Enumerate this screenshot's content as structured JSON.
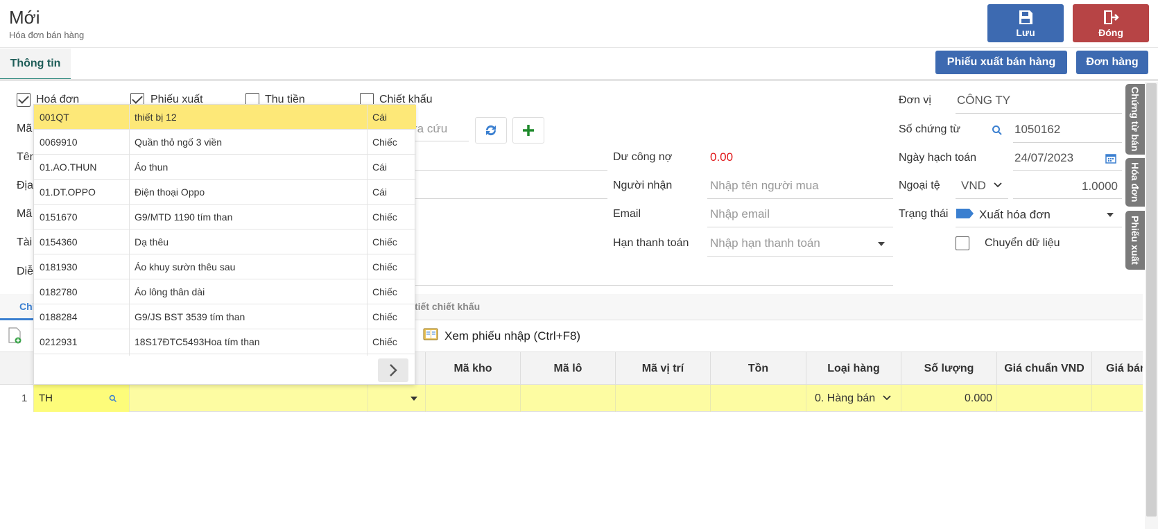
{
  "header": {
    "title": "Mới",
    "subtitle": "Hóa đơn bán hàng",
    "save_label": "Lưu",
    "close_label": "Đóng"
  },
  "tabs": {
    "info_label": "Thông tin",
    "phieu_xuat_btn": "Phiếu xuất bán hàng",
    "don_hang_btn": "Đơn hàng"
  },
  "checkboxes": [
    {
      "label": "Hoá đơn",
      "checked": true
    },
    {
      "label": "Phiếu xuất",
      "checked": true
    },
    {
      "label": "Thu tiền",
      "checked": false
    },
    {
      "label": "Chiết khấu",
      "checked": false
    }
  ],
  "left_labels": [
    "Mã",
    "Tên",
    "Địa",
    "Mã",
    "Tài",
    "Diễ"
  ],
  "lookup": {
    "placeholder_fragment": "ra cứu"
  },
  "middle": {
    "du_cong_no_label": "Dư công nợ",
    "du_cong_no_value": "0.00",
    "nguoi_nhan_label": "Người nhận",
    "nguoi_nhan_placeholder": "Nhập tên người mua",
    "email_label": "Email",
    "email_placeholder": "Nhập email",
    "han_tt_label": "Hạn thanh toán",
    "han_tt_placeholder": "Nhập hạn thanh toán"
  },
  "right": {
    "don_vi_label": "Đơn vị",
    "don_vi_value": "CÔNG TY",
    "so_chung_tu_label": "Số chứng từ",
    "so_chung_tu_value": "1050162",
    "ngay_hach_toan_label": "Ngày hạch toán",
    "ngay_hach_toan_value": "24/07/2023",
    "ngoai_te_label": "Ngoại tệ",
    "ngoai_te_value": "VND",
    "ty_gia_value": "1.0000",
    "trang_thai_label": "Trạng thái",
    "trang_thai_value": "Xuất hóa đơn",
    "chuyen_du_lieu_label": "Chuyển dữ liệu"
  },
  "side_tabs": [
    "Chứng từ bán",
    "Hóa đơn",
    "Phiếu xuất"
  ],
  "detail_tabs": {
    "first_fragment": "Chi",
    "discount_fragment": "tiết chiết khấu"
  },
  "toolbar": {
    "view_import_label": "Xem phiếu nhập (Ctrl+F8)"
  },
  "dropdown": {
    "rows": [
      {
        "code": "001QT",
        "name": "thiết bị 12",
        "unit": "Cái"
      },
      {
        "code": "0069910",
        "name": "Quần thỏ ngố 3 viền",
        "unit": "Chiếc"
      },
      {
        "code": "01.AO.THUN",
        "name": "Áo thun",
        "unit": "Cái"
      },
      {
        "code": "01.DT.OPPO",
        "name": "Điện thoại Oppo",
        "unit": "Cái"
      },
      {
        "code": "0151670",
        "name": "G9/MTD 1190 tím than",
        "unit": "Chiếc"
      },
      {
        "code": "0154360",
        "name": "Dạ thêu",
        "unit": "Chiếc"
      },
      {
        "code": "0181930",
        "name": "Áo khuy sườn thêu sau",
        "unit": "Chiếc"
      },
      {
        "code": "0182780",
        "name": "Áo lông thân dài",
        "unit": "Chiếc"
      },
      {
        "code": "0188284",
        "name": "G9/JS BST 3539 tím than",
        "unit": "Chiếc"
      },
      {
        "code": "0212931",
        "name": "18S17ĐTC5493Hoa tím than",
        "unit": "Chiếc"
      }
    ]
  },
  "grid": {
    "headers": [
      "Mã kho",
      "Mã lô",
      "Mã vị trí",
      "Tồn",
      "Loại hàng",
      "Số lượng",
      "Giá chuẩn VND",
      "Giá bán"
    ],
    "row": {
      "index": "1",
      "code_input": "TH",
      "loai_hang": "0. Hàng bán",
      "so_luong": "0.000"
    }
  },
  "colors": {
    "save": "#3d6ab1",
    "close": "#b74445",
    "accent": "#1e7f74",
    "highlight": "#fdfca2",
    "selected": "#fde878"
  }
}
